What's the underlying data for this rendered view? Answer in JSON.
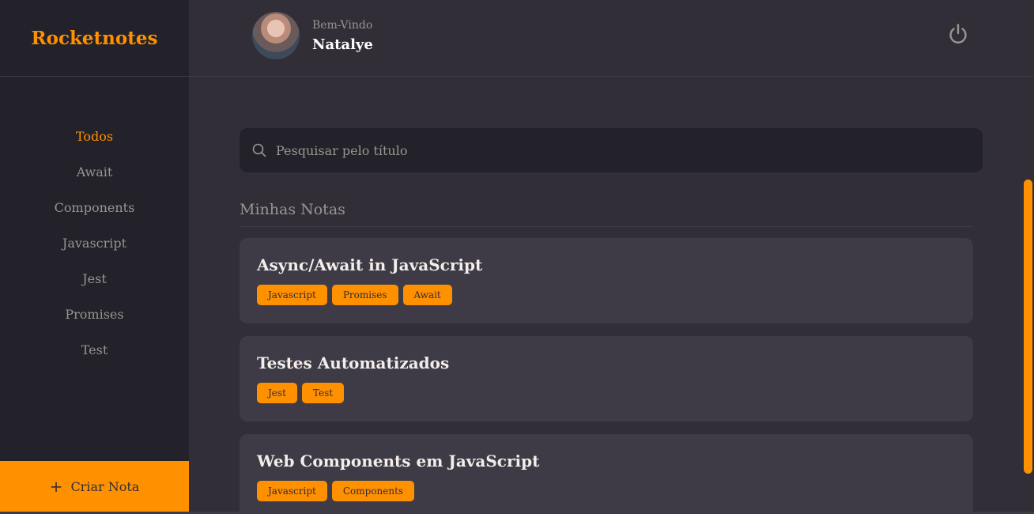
{
  "brand": {
    "title": "Rocketnotes"
  },
  "header": {
    "welcome": "Bem-Vindo",
    "user_name": "Natalye",
    "logout_icon": "power-icon"
  },
  "sidebar": {
    "items": [
      {
        "label": "Todos",
        "active": true
      },
      {
        "label": "Await",
        "active": false
      },
      {
        "label": "Components",
        "active": false
      },
      {
        "label": "Javascript",
        "active": false
      },
      {
        "label": "Jest",
        "active": false
      },
      {
        "label": "Promises",
        "active": false
      },
      {
        "label": "Test",
        "active": false
      }
    ],
    "create_button": {
      "icon": "+",
      "label": "Criar Nota"
    }
  },
  "search": {
    "placeholder": "Pesquisar pelo título",
    "value": ""
  },
  "notes_section": {
    "title": "Minhas Notas",
    "notes": [
      {
        "title": "Async/Await in JavaScript",
        "tags": [
          "Javascript",
          "Promises",
          "Await"
        ]
      },
      {
        "title": "Testes Automatizados",
        "tags": [
          "Jest",
          "Test"
        ]
      },
      {
        "title": "Web Components em JavaScript",
        "tags": [
          "Javascript",
          "Components"
        ]
      }
    ]
  },
  "colors": {
    "accent": "#ff9000",
    "background": "#312e38",
    "sidebar": "#232129",
    "card": "#3e3b47",
    "muted_text": "#999591"
  }
}
